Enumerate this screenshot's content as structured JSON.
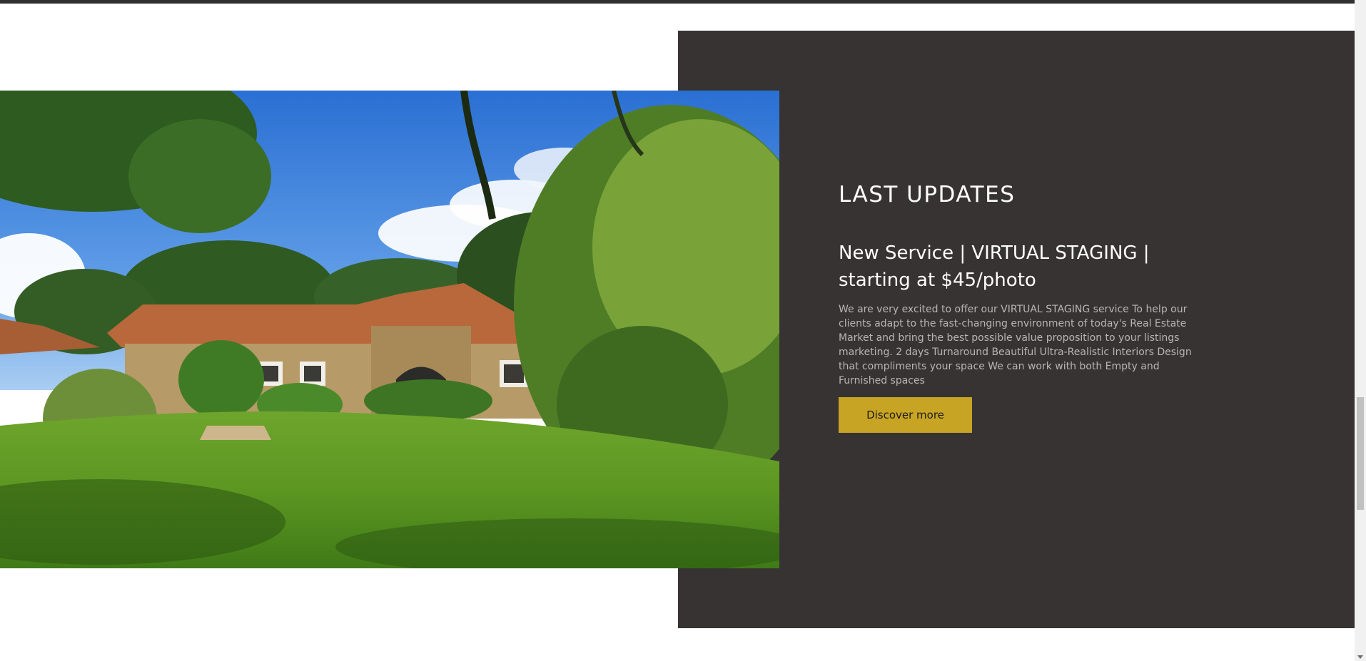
{
  "section": {
    "title": "LAST UPDATES"
  },
  "post": {
    "title": "New Service | VIRTUAL STAGING | starting at $45/photo",
    "body": "We are very excited to offer our VIRTUAL STAGING service To help our clients adapt to the fast-changing environment of today's Real Estate Market and bring the best possible value proposition to your listings marketing. 2 days Turnaround Beautiful Ultra-Realistic Interiors Design that compliments your space We can work with both Empty and Furnished spaces",
    "cta_label": "Discover more"
  },
  "colors": {
    "panel": "#373332",
    "accent": "#c7a424",
    "heading": "#ffffff",
    "body_text": "#b9b5b2"
  },
  "icons": {
    "scroll_down": "chevron-down-icon"
  }
}
